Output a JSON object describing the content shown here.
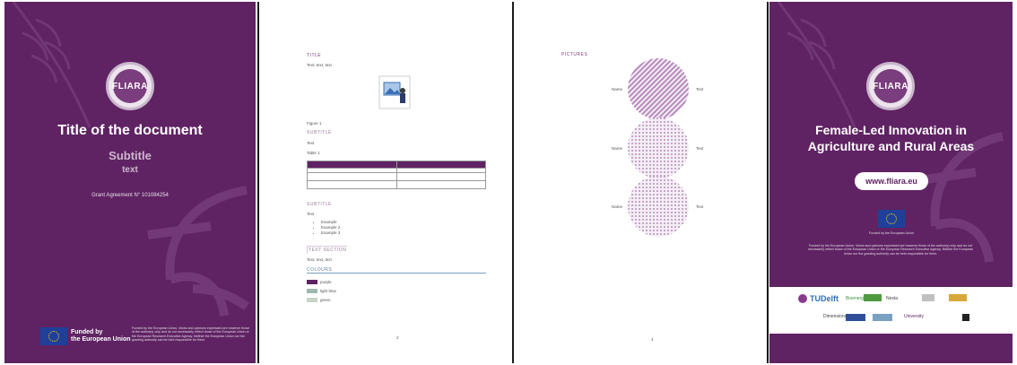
{
  "colors": {
    "brand_purple": "#5f2363",
    "light_purple": "#cdb7cf",
    "eu_blue": "#1f3f9a",
    "eu_yellow": "#ffd400"
  },
  "cover": {
    "logo_text": "FLIARA",
    "title": "Title of the document",
    "subtitle": "Subtitle",
    "text": "text",
    "grant": "Grant Agreement N° 101084254",
    "funded_line1": "Funded by",
    "funded_line2": "the European Union",
    "disclaimer": "Funded by the European Union. Views and opinions expressed are however those of the author(s) only and do not necessarily reflect those of the European Union or the European Research Executive Agency. Neither the European Union nor the granting authority can be held responsible for them."
  },
  "template_page": {
    "title_label": "TITLE",
    "title_text": "Text, text, text",
    "figure_label": "Figure 1",
    "subtitle1": "SUBTITLE",
    "subtitle1_text1": "Text",
    "subtitle1_text2": "Table 1",
    "subtitle2": "SUBTITLE",
    "subtitle2_text": "Text",
    "bullets": [
      "Example",
      "Example 2",
      "Example 3"
    ],
    "text_section": "TEXT SECTION",
    "text_section_text": "Text, text, text",
    "colours_label": "COLOURS",
    "swatches": [
      {
        "color": "#5f2363",
        "label": "purple"
      },
      {
        "color": "#9fb7b1",
        "label": "light blue"
      },
      {
        "color": "#c8d3c6",
        "label": "green"
      }
    ],
    "page_number": "2"
  },
  "pictures_page": {
    "heading": "PICTURES",
    "rows": [
      {
        "name": "Name",
        "text": "Text"
      },
      {
        "name": "Name",
        "text": "Text"
      },
      {
        "name": "Name",
        "text": "Text"
      }
    ],
    "page_number": "4"
  },
  "back_cover": {
    "logo_text": "FLIARA",
    "title_line1": "Female-Led Innovation in",
    "title_line2": "Agriculture and Rural Areas",
    "website": "www.fliara.eu",
    "funded_caption": "Funded by the European Union",
    "disclaimer": "Funded by the European Union. Views and opinions expressed are however those of the author(s) only and do not necessarily reflect those of the European Union or the European Research Executive Agency. Neither the European Union nor the granting authority can be held responsible for them.",
    "partners": [
      "TUDelft",
      "Bioenergy",
      "Nesta",
      "Dimensions",
      "University"
    ]
  }
}
